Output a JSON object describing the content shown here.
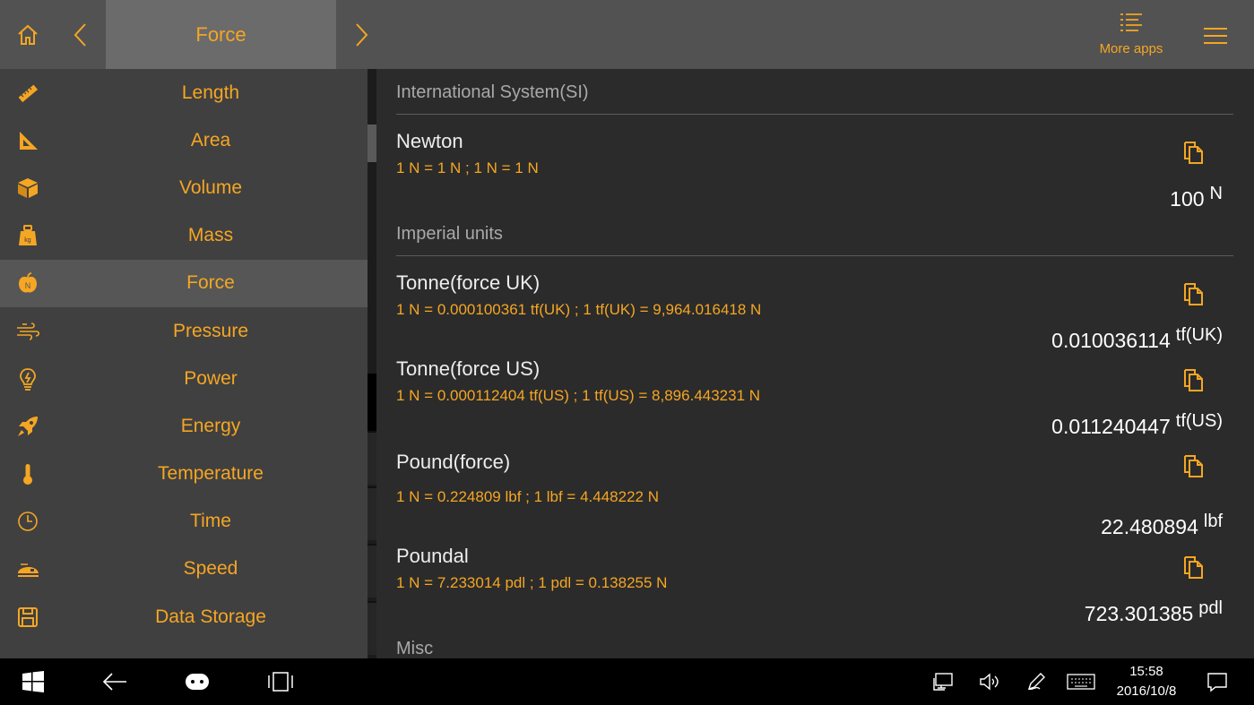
{
  "header": {
    "title": "Force",
    "more_apps_label": "More apps"
  },
  "sidebar": {
    "items": [
      {
        "label": "Length",
        "icon": "ruler-icon"
      },
      {
        "label": "Area",
        "icon": "set-square-icon"
      },
      {
        "label": "Volume",
        "icon": "cube-icon"
      },
      {
        "label": "Mass",
        "icon": "weight-kg-icon"
      },
      {
        "label": "Force",
        "icon": "apple-n-icon",
        "active": true
      },
      {
        "label": "Pressure",
        "icon": "wind-icon"
      },
      {
        "label": "Power",
        "icon": "lightbulb-icon"
      },
      {
        "label": "Energy",
        "icon": "rocket-icon"
      },
      {
        "label": "Temperature",
        "icon": "thermometer-icon"
      },
      {
        "label": "Time",
        "icon": "clock-icon"
      },
      {
        "label": "Speed",
        "icon": "train-icon"
      },
      {
        "label": "Data Storage",
        "icon": "floppy-disk-icon"
      }
    ]
  },
  "content": {
    "sections": [
      {
        "title": "International System(SI)"
      },
      {
        "title": "Imperial units"
      },
      {
        "title": "Misc"
      }
    ],
    "units": [
      {
        "name": "Newton",
        "formula": "1 N = 1 N ; 1 N = 1 N",
        "value": "100",
        "unit": "N"
      },
      {
        "name": "Tonne(force UK)",
        "formula": "1 N = 0.000100361 tf(UK) ; 1 tf(UK) = 9,964.016418 N",
        "value": "0.010036114",
        "unit": "tf(UK)"
      },
      {
        "name": "Tonne(force US)",
        "formula": "1 N = 0.000112404 tf(US) ; 1 tf(US) = 8,896.443231 N",
        "value": "0.011240447",
        "unit": "tf(US)"
      },
      {
        "name": "Pound(force)",
        "formula": "1 N = 0.224809 lbf ; 1 lbf = 4.448222 N",
        "value": "22.480894",
        "unit": "lbf"
      },
      {
        "name": "Poundal",
        "formula": "1 N = 7.233014 pdl ; 1 pdl = 0.138255 N",
        "value": "723.301385",
        "unit": "pdl"
      }
    ]
  },
  "taskbar": {
    "time": "15:58",
    "date": "2016/10/8"
  },
  "colors": {
    "accent": "#f5a623",
    "topbar": "#525252",
    "sidebar": "#404040",
    "content": "#2b2b2b",
    "taskbar": "#000000"
  }
}
